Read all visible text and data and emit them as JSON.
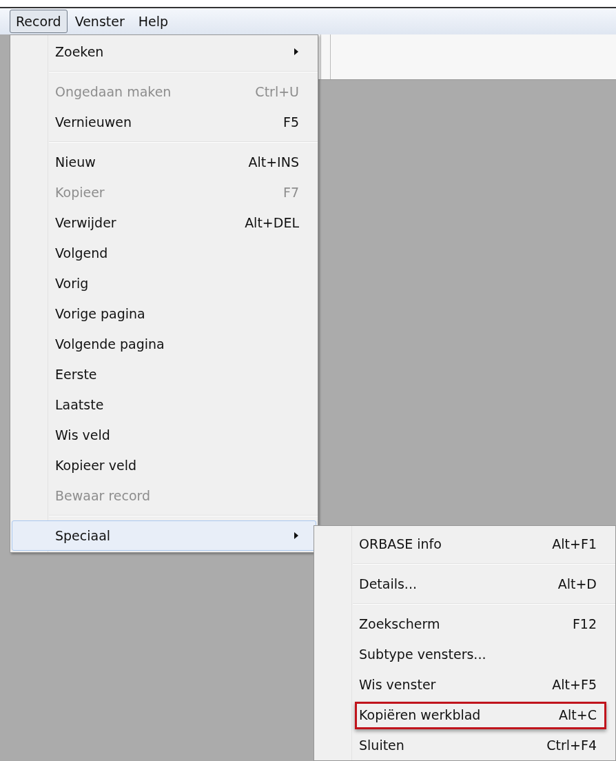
{
  "menu_bar": [
    {
      "label": "Record",
      "selected": true
    },
    {
      "label": "Venster",
      "selected": false
    },
    {
      "label": "Help",
      "selected": false
    }
  ],
  "record_menu": [
    {
      "kind": "item",
      "label": "Zoeken",
      "submenu": true,
      "disabled": false,
      "selected": false
    },
    {
      "kind": "separator"
    },
    {
      "kind": "item",
      "label": "Ongedaan maken",
      "shortcut": "Ctrl+U",
      "submenu": false,
      "disabled": true,
      "selected": false
    },
    {
      "kind": "item",
      "label": "Vernieuwen",
      "shortcut": "F5",
      "submenu": false,
      "disabled": false,
      "selected": false
    },
    {
      "kind": "separator"
    },
    {
      "kind": "item",
      "label": "Nieuw",
      "shortcut": "Alt+INS",
      "submenu": false,
      "disabled": false,
      "selected": false
    },
    {
      "kind": "item",
      "label": "Kopieer",
      "shortcut": "F7",
      "submenu": false,
      "disabled": true,
      "selected": false
    },
    {
      "kind": "item",
      "label": "Verwijder",
      "shortcut": "Alt+DEL",
      "submenu": false,
      "disabled": false,
      "selected": false
    },
    {
      "kind": "item",
      "label": "Volgend",
      "submenu": false,
      "disabled": false,
      "selected": false
    },
    {
      "kind": "item",
      "label": "Vorig",
      "submenu": false,
      "disabled": false,
      "selected": false
    },
    {
      "kind": "item",
      "label": "Vorige pagina",
      "submenu": false,
      "disabled": false,
      "selected": false
    },
    {
      "kind": "item",
      "label": "Volgende pagina",
      "submenu": false,
      "disabled": false,
      "selected": false
    },
    {
      "kind": "item",
      "label": "Eerste",
      "submenu": false,
      "disabled": false,
      "selected": false
    },
    {
      "kind": "item",
      "label": "Laatste",
      "submenu": false,
      "disabled": false,
      "selected": false
    },
    {
      "kind": "item",
      "label": "Wis veld",
      "submenu": false,
      "disabled": false,
      "selected": false
    },
    {
      "kind": "item",
      "label": "Kopieer veld",
      "submenu": false,
      "disabled": false,
      "selected": false
    },
    {
      "kind": "item",
      "label": "Bewaar record",
      "submenu": false,
      "disabled": true,
      "selected": false
    },
    {
      "kind": "separator"
    },
    {
      "kind": "item",
      "label": "Speciaal",
      "submenu": true,
      "disabled": false,
      "selected": true
    }
  ],
  "speciaal_submenu": [
    {
      "kind": "item",
      "label": "ORBASE info",
      "shortcut": "Alt+F1",
      "annotated": false
    },
    {
      "kind": "separator"
    },
    {
      "kind": "item",
      "label": "Details...",
      "shortcut": "Alt+D",
      "annotated": false
    },
    {
      "kind": "separator"
    },
    {
      "kind": "item",
      "label": "Zoekscherm",
      "shortcut": "F12",
      "annotated": false
    },
    {
      "kind": "item",
      "label": "Subtype vensters...",
      "annotated": false
    },
    {
      "kind": "item",
      "label": "Wis venster",
      "shortcut": "Alt+F5",
      "annotated": false
    },
    {
      "kind": "item",
      "label": "Kopiëren werkblad",
      "shortcut": "Alt+C",
      "annotated": true
    },
    {
      "kind": "item",
      "label": "Sluiten",
      "shortcut": "Ctrl+F4",
      "annotated": false
    }
  ]
}
